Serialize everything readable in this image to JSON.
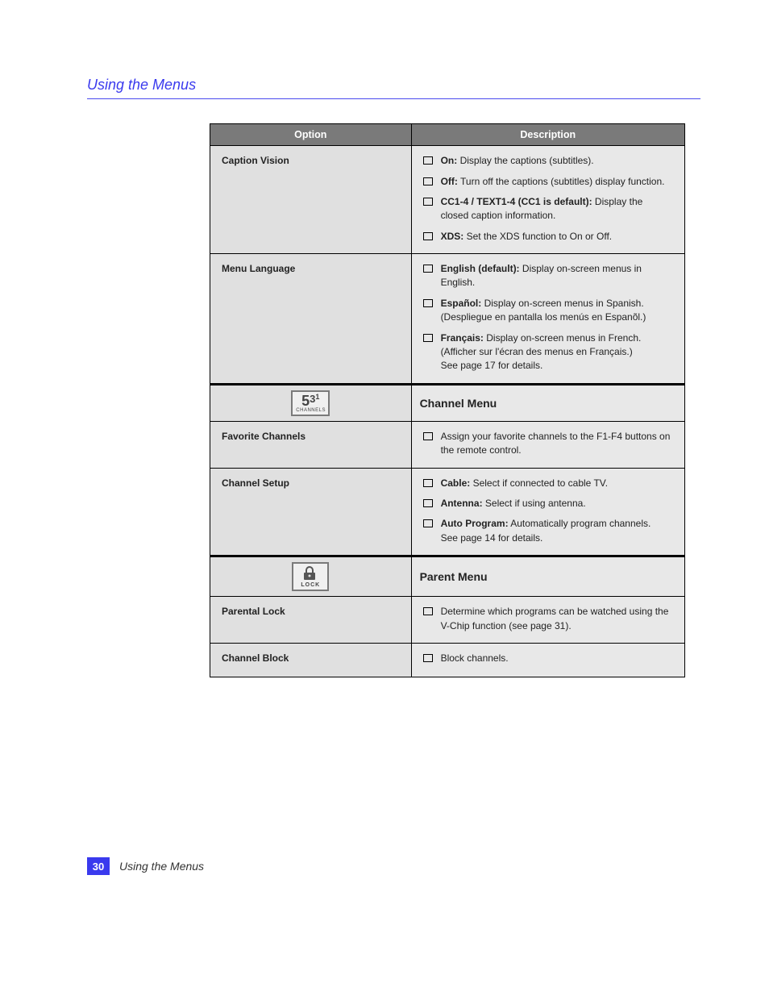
{
  "header": {
    "running_title": "Using the Menus"
  },
  "table": {
    "columns": {
      "left": "Option",
      "right": "Description"
    },
    "rows": [
      {
        "type": "option",
        "label": "Caption Vision",
        "bullets": [
          {
            "bold": "On:",
            "text": " Display the captions (subtitles)."
          },
          {
            "bold": "Off:",
            "text": " Turn off the captions (subtitles) display function."
          },
          {
            "bold": "CC1-4 / TEXT1-4 (CC1 is default):",
            "text": " Display the closed caption information."
          },
          {
            "bold": "XDS:",
            "text": " Set the XDS function to On or Off."
          }
        ]
      },
      {
        "type": "option",
        "label": "Menu Language",
        "bullets": [
          {
            "bold": "English (default):",
            "text": " Display on-screen menus in English."
          },
          {
            "bold": "Español:",
            "text": " Display on-screen menus in Spanish. (Despliegue en pantalla los menús en Espanõl.)"
          },
          {
            "bold": "Français:",
            "text": " Display on-screen menus in French. (Afficher sur l'écran des menus en Français.)",
            "note": "See page 17 for details."
          }
        ]
      },
      {
        "type": "section",
        "icon": "channels",
        "title": "Channel Menu"
      },
      {
        "type": "option",
        "label": "Favorite Channels",
        "bullets": [
          {
            "text": "Assign your favorite channels to the F1-F4 buttons on the remote control."
          }
        ]
      },
      {
        "type": "option",
        "label": "Channel Setup",
        "bullets": [
          {
            "bold": "Cable:",
            "text": " Select if connected to cable TV."
          },
          {
            "bold": "Antenna:",
            "text": " Select if using antenna."
          },
          {
            "bold": "Auto Program:",
            "text": " Automatically program channels.",
            "note": "See page 14 for details."
          }
        ]
      },
      {
        "type": "section",
        "icon": "lock",
        "title": "Parent Menu"
      },
      {
        "type": "option",
        "label": "Parental Lock",
        "bullets": [
          {
            "text": "Determine which programs can be watched using the V-Chip function (see page 31)."
          }
        ]
      },
      {
        "type": "option",
        "label": "Channel Block",
        "bullets": [
          {
            "text": "Block channels."
          }
        ]
      }
    ]
  },
  "footer": {
    "page_number": "30",
    "text": "Using the Menus"
  }
}
